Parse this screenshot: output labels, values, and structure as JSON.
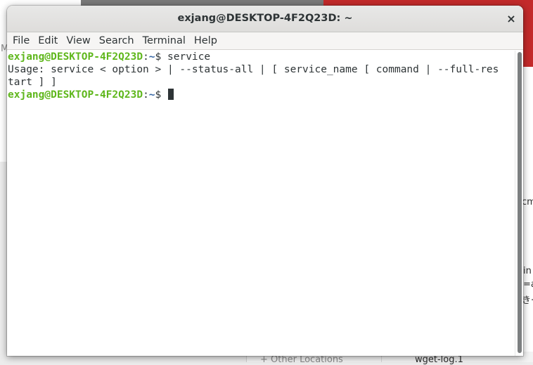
{
  "background": {
    "left_partial_text": "M",
    "right_partial_1": "cm",
    "right_partial_2": "in",
    "right_partial_3": "=a",
    "right_partial_4": "き‧",
    "bottom_location": "Other Locations",
    "bottom_file": "wget-log.1"
  },
  "window": {
    "title": "exjang@DESKTOP-4F2Q23D: ~",
    "close_glyph": "×"
  },
  "menu": [
    "File",
    "Edit",
    "View",
    "Search",
    "Terminal",
    "Help"
  ],
  "terminal": {
    "prompt_user": "exjang@DESKTOP-4F2Q23D",
    "prompt_sep": ":",
    "prompt_path": "~",
    "prompt_dollar": "$ ",
    "command": "service",
    "output_line_1": "Usage: service < option > | --status-all | [ service_name [ command | --full-res",
    "output_line_2": "tart ] ]"
  },
  "colors": {
    "prompt_user": "#5fb71c",
    "prompt_path": "#3465a4",
    "text": "#2e3436",
    "accent_red": "#c32a2a"
  }
}
